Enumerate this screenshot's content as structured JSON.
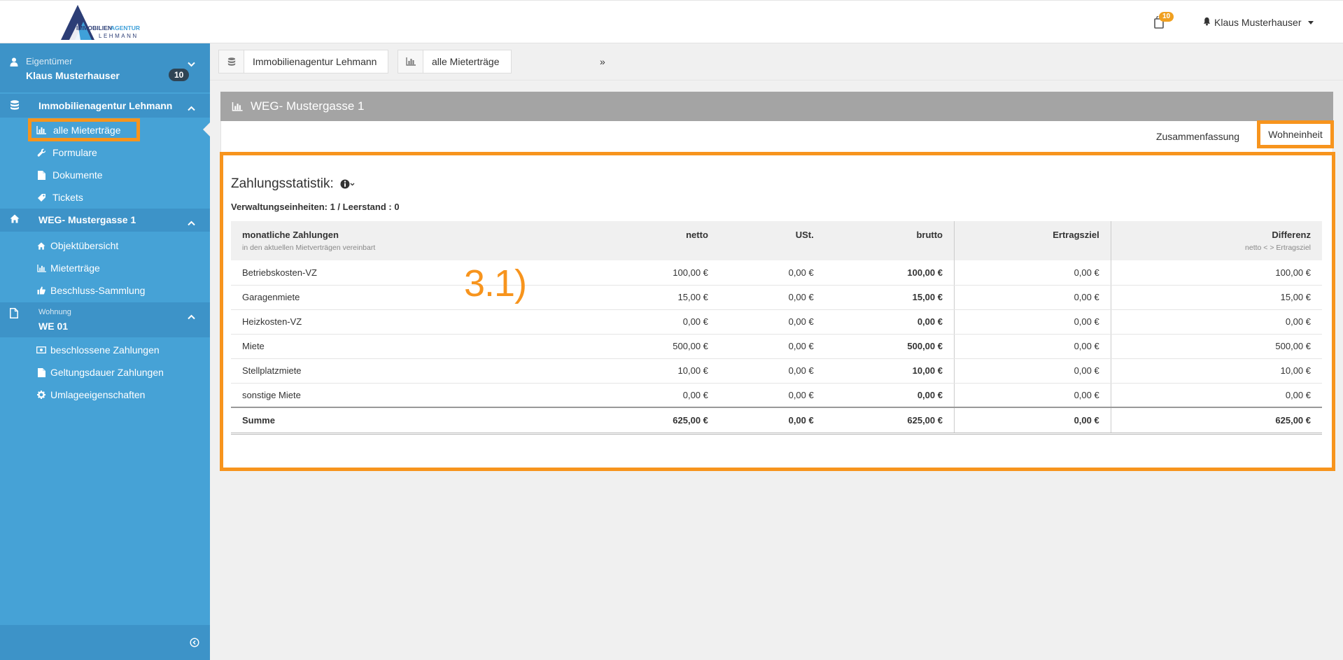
{
  "header": {
    "logo_line1": "IMMOBILIEN AGENTUR",
    "logo_line2": "LEHMANN",
    "cart_count": "10",
    "user_name": "Klaus Musterhauser"
  },
  "sidebar": {
    "owner_role": "Eigentümer",
    "owner_name": "Klaus Musterhauser",
    "owner_badge": "10",
    "group1_title": "Immobilienagentur Lehmann",
    "group1_items": [
      "alle Mieterträge",
      "Formulare",
      "Dokumente",
      "Tickets"
    ],
    "group2_title": "WEG- Mustergasse 1",
    "group2_items": [
      "Objektübersicht",
      "Mieterträge",
      "Beschluss-Sammlung"
    ],
    "group3_subtitle": "Wohnung",
    "group3_title": "WE 01",
    "group3_items": [
      "beschlossene Zahlungen",
      "Geltungsdauer Zahlungen",
      "Umlageeigenschaften"
    ]
  },
  "breadcrumb": {
    "item1": "Immobilienagentur Lehmann",
    "separator": "»",
    "item2": "alle Mieterträge"
  },
  "panel": {
    "title": "WEG- Mustergasse 1",
    "tab_summary": "Zusammenfassung",
    "tab_unit": "Wohneinheit"
  },
  "stats": {
    "title": "Zahlungsstatistik:",
    "units_line": "Verwaltungseinheiten: 1 / Leerstand : 0"
  },
  "table": {
    "headers": {
      "label": "monatliche Zahlungen",
      "label_sub": "in den aktuellen Mietverträgen vereinbart",
      "netto": "netto",
      "ust": "USt.",
      "brutto": "brutto",
      "ertragsziel": "Ertragsziel",
      "differenz": "Differenz",
      "differenz_sub": "netto < > Ertragsziel"
    },
    "rows": [
      {
        "label": "Betriebskosten-VZ",
        "netto": "100,00 €",
        "ust": "0,00 €",
        "brutto": "100,00 €",
        "ertragsziel": "0,00 €",
        "differenz": "100,00 €"
      },
      {
        "label": "Garagenmiete",
        "netto": "15,00 €",
        "ust": "0,00 €",
        "brutto": "15,00 €",
        "ertragsziel": "0,00 €",
        "differenz": "15,00 €"
      },
      {
        "label": "Heizkosten-VZ",
        "netto": "0,00 €",
        "ust": "0,00 €",
        "brutto": "0,00 €",
        "ertragsziel": "0,00 €",
        "differenz": "0,00 €"
      },
      {
        "label": "Miete",
        "netto": "500,00 €",
        "ust": "0,00 €",
        "brutto": "500,00 €",
        "ertragsziel": "0,00 €",
        "differenz": "500,00 €"
      },
      {
        "label": "Stellplatzmiete",
        "netto": "10,00 €",
        "ust": "0,00 €",
        "brutto": "10,00 €",
        "ertragsziel": "0,00 €",
        "differenz": "10,00 €"
      },
      {
        "label": "sonstige Miete",
        "netto": "0,00 €",
        "ust": "0,00 €",
        "brutto": "0,00 €",
        "ertragsziel": "0,00 €",
        "differenz": "0,00 €"
      }
    ],
    "sum": {
      "label": "Summe",
      "netto": "625,00 €",
      "ust": "0,00 €",
      "brutto": "625,00 €",
      "ertragsziel": "0,00 €",
      "differenz": "625,00 €"
    }
  },
  "annotation": "3.1)",
  "colors": {
    "sidebar": "#46a2d6",
    "sidebar_dark": "#3d93c8",
    "highlight": "#f7941d",
    "panel_header": "#a4a4a4"
  }
}
